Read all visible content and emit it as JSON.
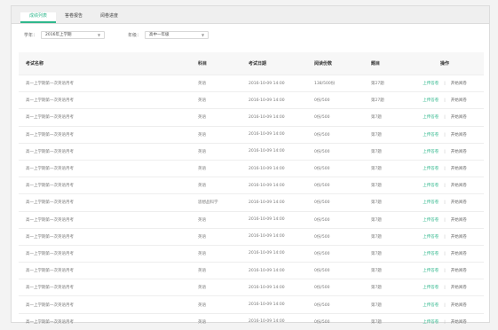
{
  "tabs": [
    {
      "label": "成绩列表",
      "active": true
    },
    {
      "label": "答卷报告",
      "active": false
    },
    {
      "label": "阅卷进度",
      "active": false
    }
  ],
  "filters": {
    "term_label": "学年：",
    "term_value": "2016年上学期",
    "grade_label": "年级：",
    "grade_value": "高中一年级"
  },
  "table": {
    "headers": [
      "考试名称",
      "科目",
      "考试日期",
      "阅读份数",
      "题目",
      "操作"
    ],
    "rows": [
      {
        "name": "高一上学期第一次英语月考",
        "subject": "英语",
        "date": "2016-10-09 14:00",
        "count": "138/500份",
        "items": "第27题",
        "action1": "上传答卷",
        "action2": "开始阅卷"
      },
      {
        "name": "高一上学期第一次英语月考",
        "subject": "英语",
        "date": "2016-10-09 14:00",
        "count": "0份/500",
        "items": "第27题",
        "action1": "上传答卷",
        "action2": "开始阅卷"
      },
      {
        "name": "高一上学期第一次英语月考",
        "subject": "英语",
        "date": "2016-10-09 14:00",
        "count": "0份/500",
        "items": "第7题",
        "action1": "上传答卷",
        "action2": "开始阅卷"
      },
      {
        "name": "高一上学期第一次英语月考",
        "subject": "英语",
        "date": "2016-10-09 14:00",
        "count": "0份/500",
        "items": "第7题",
        "action1": "上传答卷",
        "action2": "开始阅卷"
      },
      {
        "name": "高一上学期第一次英语月考",
        "subject": "英语",
        "date": "2016-10-09 14:00",
        "count": "0份/500",
        "items": "第7题",
        "action1": "上传答卷",
        "action2": "开始阅卷"
      },
      {
        "name": "高一上学期第一次英语月考",
        "subject": "英语",
        "date": "2016-10-09 14:00",
        "count": "0份/500",
        "items": "第7题",
        "action1": "上传答卷",
        "action2": "开始阅卷"
      },
      {
        "name": "高一上学期第一次英语月考",
        "subject": "英语",
        "date": "2016-10-09 14:00",
        "count": "0份/500",
        "items": "第7题",
        "action1": "上传答卷",
        "action2": "开始阅卷"
      },
      {
        "name": "高一上学期第一次英语月考",
        "subject": "思想品科学",
        "date": "2016-10-09 14:00",
        "count": "0份/500",
        "items": "第7题",
        "action1": "上传答卷",
        "action2": "开始阅卷"
      },
      {
        "name": "高一上学期第一次英语月考",
        "subject": "英语",
        "date": "2016-10-09 14:00",
        "count": "0份/500",
        "items": "第7题",
        "action1": "上传答卷",
        "action2": "开始阅卷"
      },
      {
        "name": "高一上学期第一次英语月考",
        "subject": "英语",
        "date": "2016-10-09 14:00",
        "count": "0份/500",
        "items": "第7题",
        "action1": "上传答卷",
        "action2": "开始阅卷"
      },
      {
        "name": "高一上学期第一次英语月考",
        "subject": "英语",
        "date": "2016-10-09 14:00",
        "count": "0份/500",
        "items": "第7题",
        "action1": "上传答卷",
        "action2": "开始阅卷"
      },
      {
        "name": "高一上学期第一次英语月考",
        "subject": "英语",
        "date": "2016-10-09 14:00",
        "count": "0份/500",
        "items": "第7题",
        "action1": "上传答卷",
        "action2": "开始阅卷"
      },
      {
        "name": "高一上学期第一次英语月考",
        "subject": "英语",
        "date": "2016-10-09 14:00",
        "count": "0份/500",
        "items": "第7题",
        "action1": "上传答卷",
        "action2": "开始阅卷"
      },
      {
        "name": "高一上学期第一次英语月考",
        "subject": "英语",
        "date": "2016-10-09 14:00",
        "count": "0份/500",
        "items": "第7题",
        "action1": "上传答卷",
        "action2": "开始阅卷"
      },
      {
        "name": "高一上学期第一次英语月考",
        "subject": "英语",
        "date": "2016-10-09 14:00",
        "count": "0份/500",
        "items": "第7题",
        "action1": "上传答卷",
        "action2": "开始阅卷"
      }
    ]
  },
  "colors": {
    "accent": "#2fb78c",
    "tabbar": "#efefef",
    "header_row": "#f7f7f7"
  },
  "icons": {
    "dropdown": "chevron-down-icon"
  }
}
